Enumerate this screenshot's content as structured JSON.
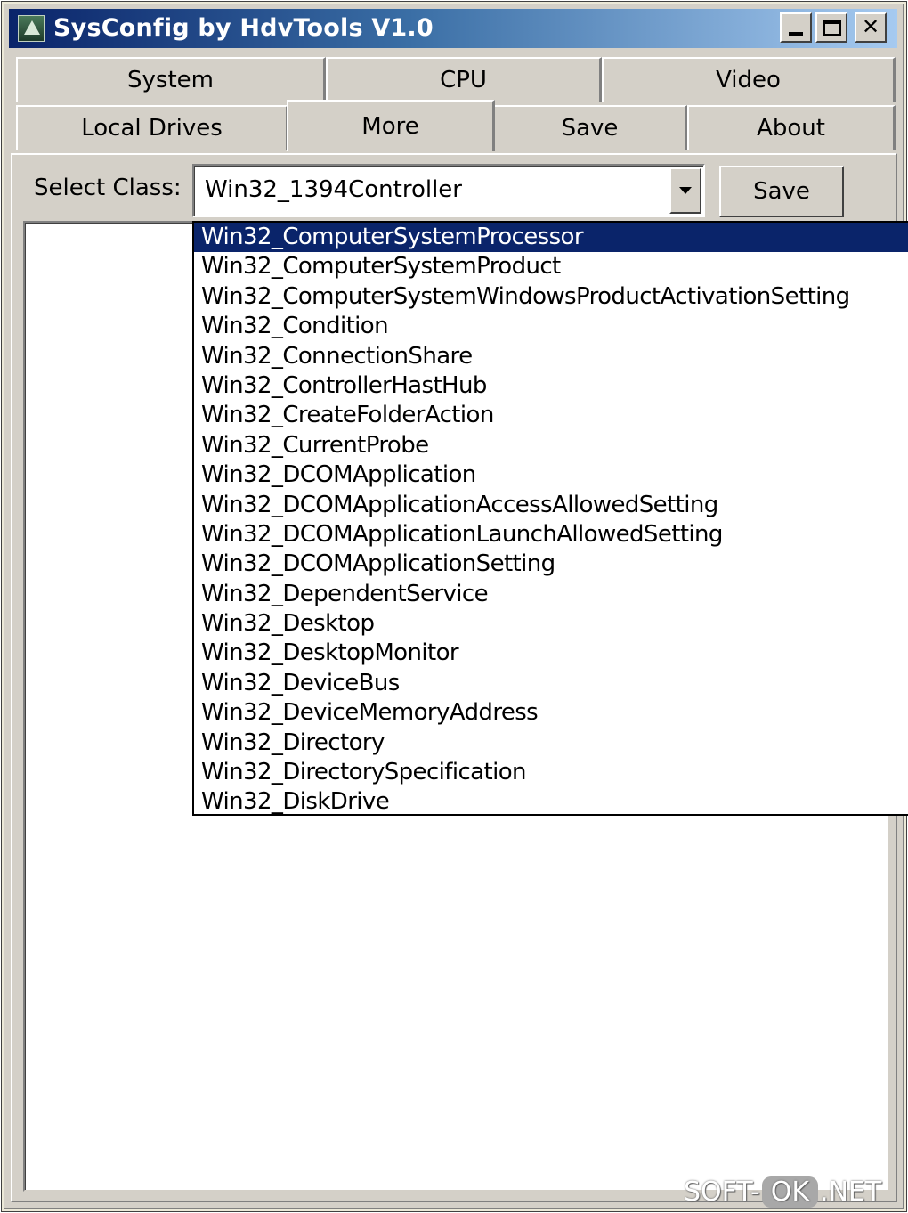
{
  "window": {
    "title": "SysConfig by HdvTools V1.0",
    "minimize_glyph": "minimize-icon",
    "maximize_glyph": "maximize-icon",
    "close_label": "✕"
  },
  "tabs": {
    "row1": [
      "System",
      "CPU",
      "Video"
    ],
    "row2": [
      "Local Drives",
      "More",
      "Save",
      "About"
    ],
    "selected": "More"
  },
  "toolbar": {
    "select_label": "Select Class:",
    "combo_value": "Win32_1394Controller",
    "save_label": "Save"
  },
  "dropdown": {
    "selected_index": 0,
    "items": [
      "Win32_ComputerSystemProcessor",
      "Win32_ComputerSystemProduct",
      "Win32_ComputerSystemWindowsProductActivationSetting",
      "Win32_Condition",
      "Win32_ConnectionShare",
      "Win32_ControllerHastHub",
      "Win32_CreateFolderAction",
      "Win32_CurrentProbe",
      "Win32_DCOMApplication",
      "Win32_DCOMApplicationAccessAllowedSetting",
      "Win32_DCOMApplicationLaunchAllowedSetting",
      "Win32_DCOMApplicationSetting",
      "Win32_DependentService",
      "Win32_Desktop",
      "Win32_DesktopMonitor",
      "Win32_DeviceBus",
      "Win32_DeviceMemoryAddress",
      "Win32_Directory",
      "Win32_DirectorySpecification",
      "Win32_DiskDrive"
    ]
  },
  "watermark": {
    "left": "SOFT-",
    "mid": "OK",
    "right": ".NET"
  },
  "colors": {
    "face": "#d4d0c8",
    "selection": "#0a246a",
    "title_start": "#0a246a",
    "title_end": "#a6caf0"
  }
}
